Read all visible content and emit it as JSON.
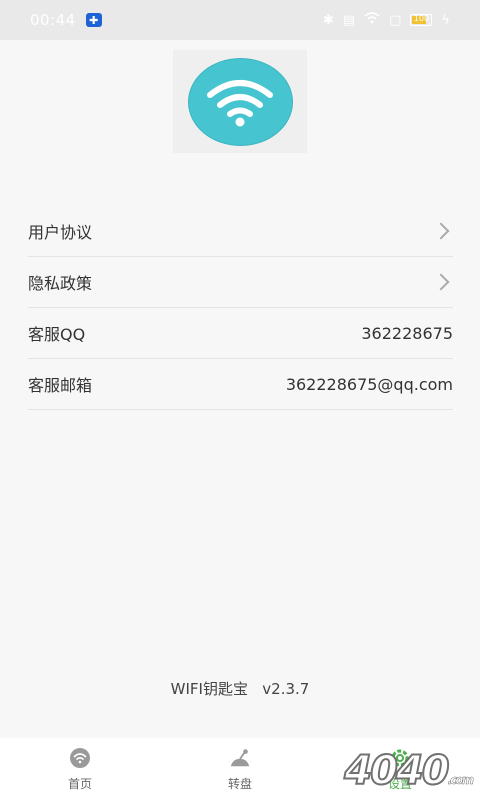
{
  "status_bar": {
    "time": "00:44",
    "battery_text": "100"
  },
  "settings_list": [
    {
      "label": "用户协议",
      "value": "",
      "has_chevron": true
    },
    {
      "label": "隐私政策",
      "value": "",
      "has_chevron": true
    },
    {
      "label": "客服QQ",
      "value": "362228675",
      "has_chevron": false
    },
    {
      "label": "客服邮箱",
      "value": "362228675@qq.com",
      "has_chevron": false
    }
  ],
  "version_text": "WIFI钥匙宝   v2.3.7",
  "bottom_nav": [
    {
      "label": "首页",
      "icon": "wifi-icon"
    },
    {
      "label": "转盘",
      "icon": "wheel-icon"
    },
    {
      "label": "设置",
      "icon": "gear-icon",
      "active": true
    }
  ],
  "watermark": {
    "text": "4040",
    "suffix": ".com"
  },
  "colors": {
    "accent_teal": "#46c5d0",
    "active_green": "#4caf50",
    "app_badge_blue": "#1e63d6"
  }
}
